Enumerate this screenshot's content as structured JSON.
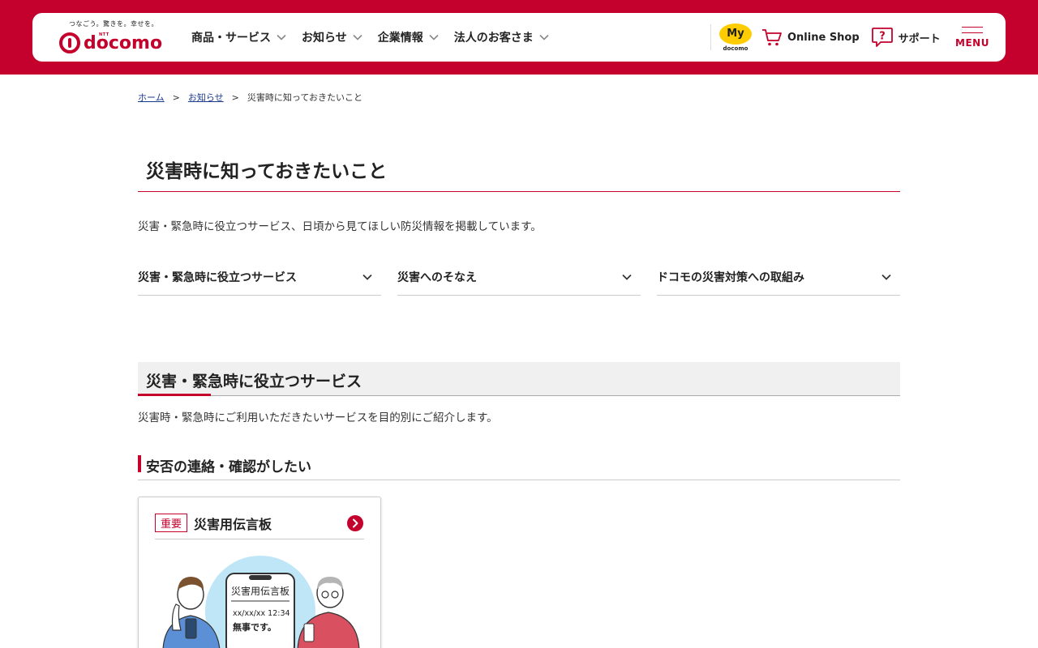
{
  "header": {
    "logo": {
      "tagline": "つなごう。驚きを。幸せを。",
      "ntt": "NTT",
      "brand": "docomo"
    },
    "nav": [
      {
        "label": "商品・サービス"
      },
      {
        "label": "お知らせ"
      },
      {
        "label": "企業情報"
      },
      {
        "label": "法人のお客さま"
      }
    ],
    "my_docomo": {
      "main": "My",
      "sub": "docomo"
    },
    "online_shop": "Online Shop",
    "support": "サポート",
    "menu": "MENU"
  },
  "breadcrumb": {
    "home": "ホーム",
    "news": "お知らせ",
    "current": "災害時に知っておきたいこと",
    "separator": ">"
  },
  "page": {
    "title": "災害時に知っておきたいこと",
    "lead": "災害・緊急時に役立つサービス、日頃から見てほしい防災情報を掲載しています。"
  },
  "anchors": [
    {
      "label": "災害・緊急時に役立つサービス"
    },
    {
      "label": "災害へのそなえ"
    },
    {
      "label": "ドコモの災害対策への取組み"
    }
  ],
  "section": {
    "title": "災害・緊急時に役立つサービス",
    "lead": "災害時・緊急時にご利用いただきたいサービスを目的別にご紹介します。",
    "subsection": {
      "title": "安否の連絡・確認がしたい",
      "card": {
        "tag": "重要",
        "title": "災害用伝言板",
        "illustration": {
          "screen_title": "災害用伝言板",
          "screen_date": "xx/xx/xx 12:34",
          "screen_message": "無事です。"
        }
      }
    }
  },
  "colors": {
    "brand_red": "#c4002c",
    "my_yellow": "#ffcc00",
    "link_blue": "#1a3a8c"
  }
}
